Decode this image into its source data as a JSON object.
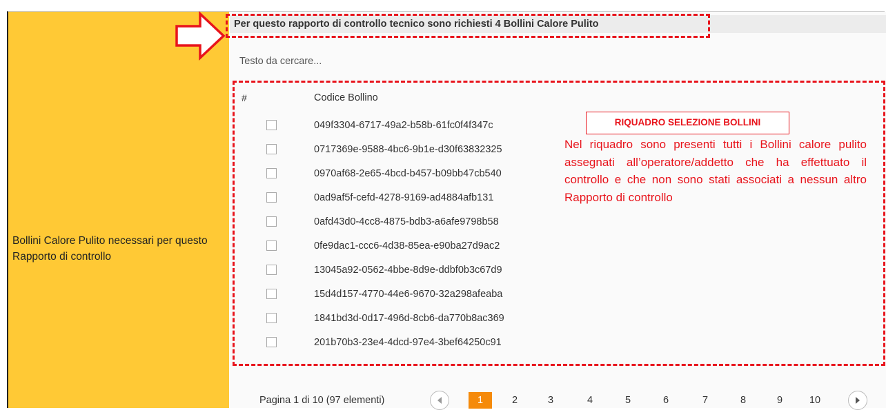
{
  "form": {
    "field_label": "Bollini Calore Pulito necessari per questo Rapporto di controllo",
    "header_text": "Per questo rapporto di controllo tecnico sono richiesti 4 Bollini Calore Pulito"
  },
  "search": {
    "placeholder": "Testo da cercare..."
  },
  "grid": {
    "columns": [
      "#",
      "Codice Bollino"
    ],
    "rows": [
      "049f3304-6717-49a2-b58b-61fc0f4f347c",
      "0717369e-9588-4bc6-9b1e-d30f63832325",
      "0970af68-2e65-4bcd-b457-b09bb47cb540",
      "0ad9af5f-cefd-4278-9169-ad4884afb131",
      "0afd43d0-4cc8-4875-bdb3-a6afe9798b58",
      "0fe9dac1-ccc6-4d38-85ea-e90ba27d9ac2",
      "13045a92-0562-4bbe-8d9e-ddbf0b3c67d9",
      "15d4d157-4770-44e6-9670-32a298afeaba",
      "1841bd3d-0d17-496d-8cb6-da770b8ac369",
      "201b70b3-23e4-4dcd-97e4-3bef64250c91"
    ]
  },
  "annotation": {
    "title": "RIQUADRO SELEZIONE BOLLINI",
    "note": "Nel riquadro sono presenti tutti i Bollini calore pulito assegnati all’operatore/addetto che ha effettuato il controllo e che non sono stati associati a nessun altro Rapporto di controllo"
  },
  "pager": {
    "info": "Pagina 1 di 10 (97 elementi)",
    "current": "1",
    "pages": [
      "2",
      "3",
      "4",
      "5",
      "6",
      "7",
      "8",
      "9",
      "10"
    ]
  },
  "colors": {
    "panel": "#ffc935",
    "annotation_red": "#e8141c",
    "active_page": "#f58a0a"
  },
  "icons": {
    "arrow": "red-arrow-right-icon",
    "prev": "chevron-left-icon",
    "next": "chevron-right-icon"
  }
}
